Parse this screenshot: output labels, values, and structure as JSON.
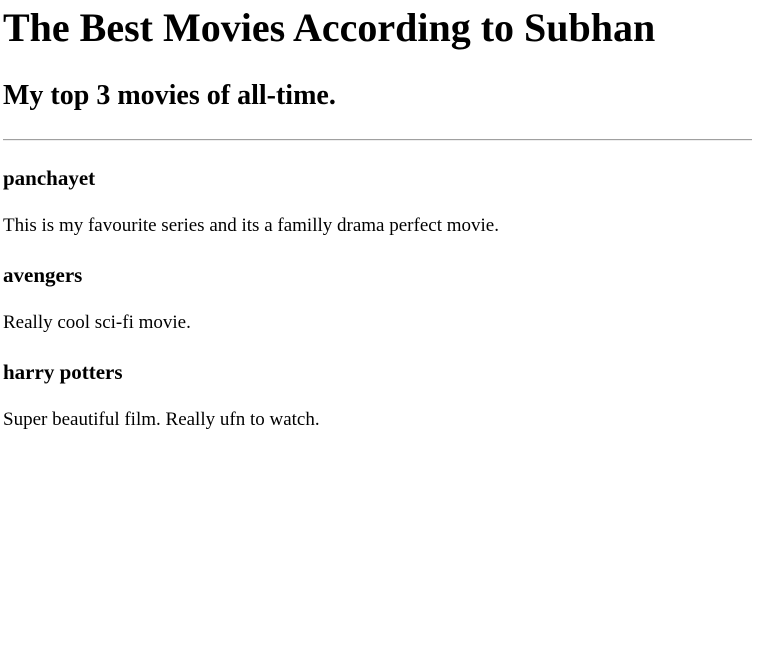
{
  "page": {
    "title": "The Best Movies According to Subhan",
    "subtitle": "My top 3 movies of all-time."
  },
  "movies": [
    {
      "name": "panchayet",
      "description": "This is my favourite series and its a familly drama perfect movie."
    },
    {
      "name": "avengers",
      "description": "Really cool sci-fi movie."
    },
    {
      "name": "harry potters",
      "description": "Super beautiful film. Really ufn to watch."
    }
  ]
}
